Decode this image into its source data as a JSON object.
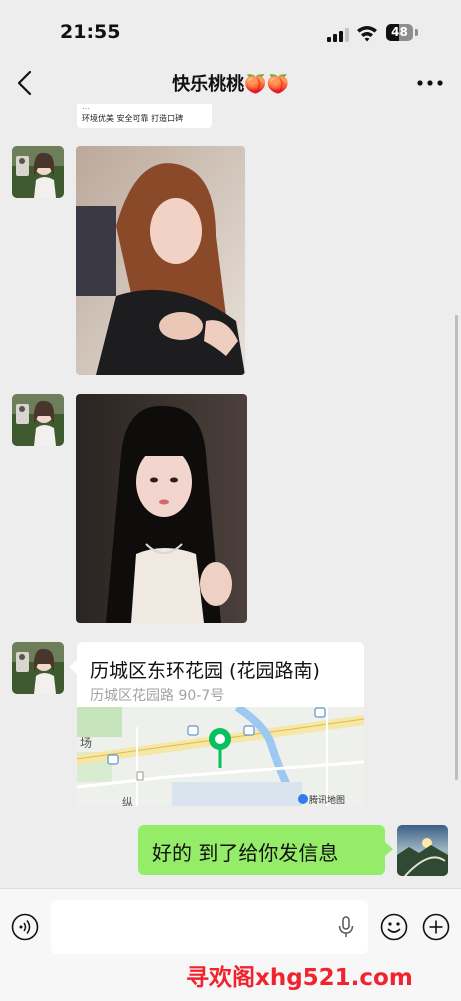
{
  "status_bar": {
    "time": "21:55",
    "battery_level": "48"
  },
  "header": {
    "title": "快乐桃桃🍑🍑"
  },
  "messages": {
    "top_fragment": {
      "line1": "…",
      "line2": "环境优美 安全可靠 打造口碑"
    },
    "location": {
      "title": "历城区东环花园 (花园路南)",
      "address": "历城区花园路 90-7号",
      "map_labels": {
        "left": "场",
        "bottom": "纵"
      },
      "map_credit": "腾讯地图"
    },
    "my_message": "好的 到了给你发信息"
  },
  "input": {
    "placeholder": ""
  },
  "watermark": "寻欢阁xhg521.com",
  "colors": {
    "background": "#ededed",
    "my_bubble": "#95ec69",
    "watermark": "#f0232f",
    "map_pin": "#07c160"
  }
}
